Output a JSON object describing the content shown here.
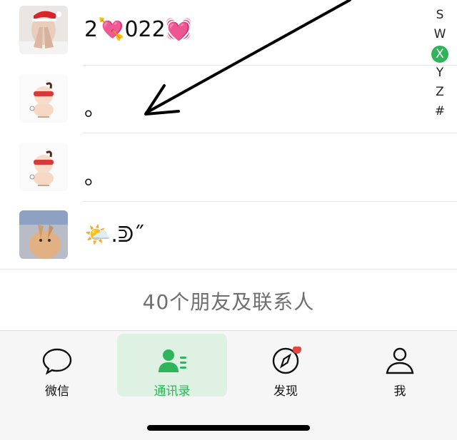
{
  "contacts": [
    {
      "name": "2💘022💓",
      "avatar": "avatar-photo"
    },
    {
      "name": "。",
      "avatar": "avatar-cartoon"
    },
    {
      "name": "。",
      "avatar": "avatar-cartoon"
    },
    {
      "name": "🌤️.ᕲ˝",
      "avatar": "avatar-cat-photo"
    }
  ],
  "index_bar": {
    "letters": [
      "S",
      "W",
      "X",
      "Y",
      "Z",
      "#"
    ],
    "active": "X"
  },
  "friend_count": "40个朋友及联系人",
  "tabbar": {
    "tabs": [
      {
        "label": "微信",
        "icon": "chat-bubble-icon"
      },
      {
        "label": "通讯录",
        "icon": "contacts-icon"
      },
      {
        "label": "发现",
        "icon": "compass-icon"
      },
      {
        "label": "我",
        "icon": "person-icon"
      }
    ],
    "active_index": 1
  },
  "colors": {
    "accent": "#2fb45a",
    "active_tab_bg": "#dff1e3",
    "badge": "#e64545"
  }
}
